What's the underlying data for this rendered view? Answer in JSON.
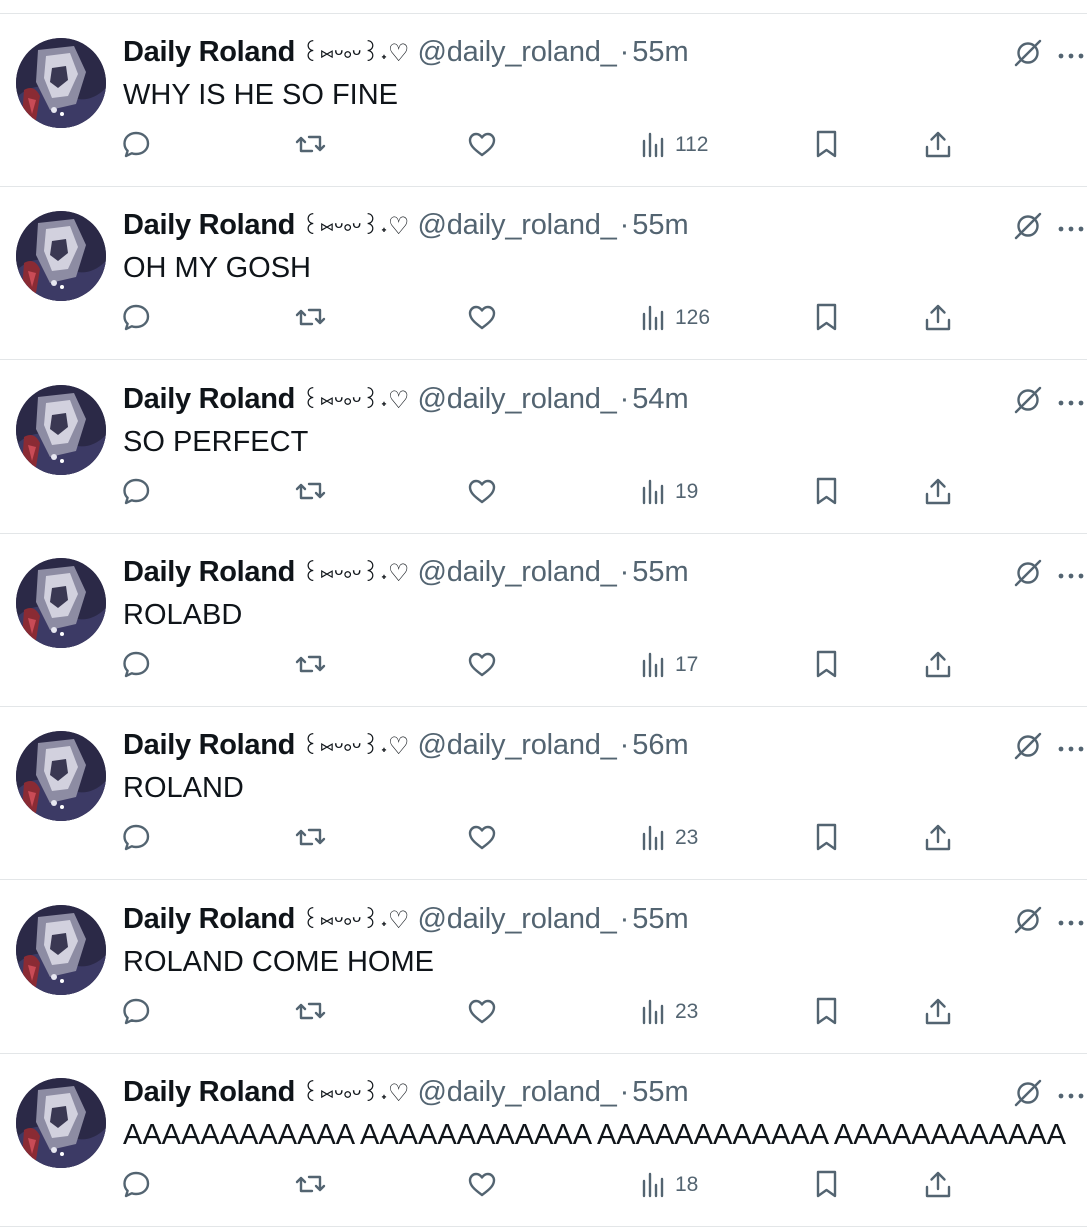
{
  "tweets": [
    {
      "author_name": "Daily Roland",
      "decoration": "꒰⑅ᵕ༚ᵕ꒱˖♡",
      "handle": "@daily_roland_",
      "separator": "·",
      "time": "55m",
      "text": "WHY IS HE SO FINE",
      "views": "112"
    },
    {
      "author_name": "Daily Roland",
      "decoration": "꒰⑅ᵕ༚ᵕ꒱˖♡",
      "handle": "@daily_roland_",
      "separator": "·",
      "time": "55m",
      "text": "OH MY GOSH",
      "views": "126"
    },
    {
      "author_name": "Daily Roland",
      "decoration": "꒰⑅ᵕ༚ᵕ꒱˖♡",
      "handle": "@daily_roland_",
      "separator": "·",
      "time": "54m",
      "text": "SO PERFECT",
      "views": "19"
    },
    {
      "author_name": "Daily Roland",
      "decoration": "꒰⑅ᵕ༚ᵕ꒱˖♡",
      "handle": "@daily_roland_",
      "separator": "·",
      "time": "55m",
      "text": "ROLABD",
      "views": "17"
    },
    {
      "author_name": "Daily Roland",
      "decoration": "꒰⑅ᵕ༚ᵕ꒱˖♡",
      "handle": "@daily_roland_",
      "separator": "·",
      "time": "56m",
      "text": "ROLAND",
      "views": "23"
    },
    {
      "author_name": "Daily Roland",
      "decoration": "꒰⑅ᵕ༚ᵕ꒱˖♡",
      "handle": "@daily_roland_",
      "separator": "·",
      "time": "55m",
      "text": "ROLAND COME HOME",
      "views": "23"
    },
    {
      "author_name": "Daily Roland",
      "decoration": "꒰⑅ᵕ༚ᵕ꒱˖♡",
      "handle": "@daily_roland_",
      "separator": "·",
      "time": "55m",
      "text": "AAAAAAAAAAAA AAAAAAAAAAAA AAAAAAAAAAAA AAAAAAAAAAAA",
      "views": "18"
    }
  ],
  "icons": {
    "reply": "reply-icon",
    "retweet": "retweet-icon",
    "like": "like-icon",
    "views": "views-icon",
    "bookmark": "bookmark-icon",
    "share": "share-icon",
    "muted": "muted-icon",
    "more": "more-icon"
  },
  "colors": {
    "text": "#0f1419",
    "secondary": "#536471",
    "divider": "#e3e6e8",
    "background": "#ffffff"
  }
}
